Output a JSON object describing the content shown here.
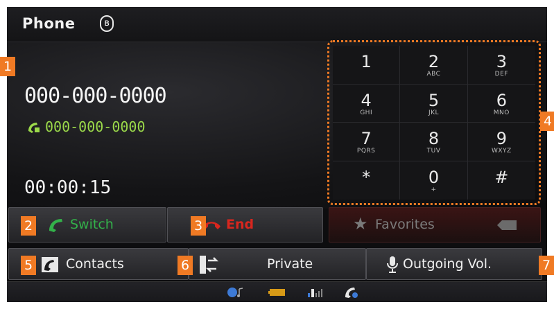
{
  "header": {
    "title": "Phone",
    "bluetooth_icon": "bluetooth-icon"
  },
  "call": {
    "number": "000-000-0000",
    "secondary_number": "000-000-0000",
    "timer": "00:00:15"
  },
  "keypad": {
    "keys": [
      {
        "digit": "1",
        "letters": ""
      },
      {
        "digit": "2",
        "letters": "ABC"
      },
      {
        "digit": "3",
        "letters": "DEF"
      },
      {
        "digit": "4",
        "letters": "GHI"
      },
      {
        "digit": "5",
        "letters": "JKL"
      },
      {
        "digit": "6",
        "letters": "MNO"
      },
      {
        "digit": "7",
        "letters": "PQRS"
      },
      {
        "digit": "8",
        "letters": "TUV"
      },
      {
        "digit": "9",
        "letters": "WXYZ"
      },
      {
        "digit": "*",
        "letters": ""
      },
      {
        "digit": "0",
        "letters": "+"
      },
      {
        "digit": "#",
        "letters": ""
      }
    ]
  },
  "buttons": {
    "switch": "Switch",
    "end": "End",
    "favorites": "Favorites",
    "contacts": "Contacts",
    "private": "Private",
    "outgoing_vol": "Outgoing Vol."
  },
  "markers": [
    "1",
    "2",
    "3",
    "4",
    "5",
    "6",
    "7"
  ],
  "colors": {
    "accent": "#f07a24",
    "green": "#9bd94a",
    "end_red": "#d8261e",
    "switch_green": "#33b24a"
  },
  "status_icons": [
    "bluetooth-music-icon",
    "battery-icon",
    "signal-icon",
    "phone-icon"
  ]
}
